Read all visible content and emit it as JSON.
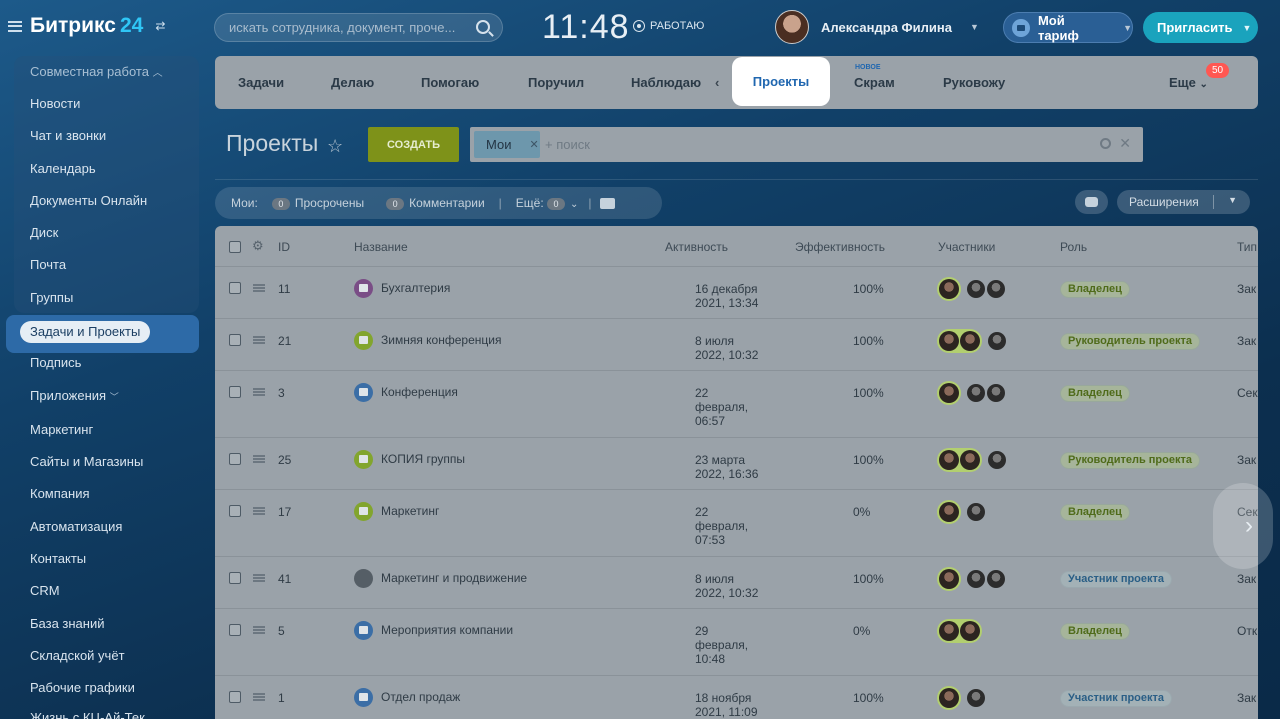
{
  "header": {
    "logo_text": "Битрикс",
    "logo_num": "24",
    "search_placeholder": "искать сотрудника, документ, проче...",
    "clock": "11:48",
    "work_status": "РАБОТАЮ",
    "user_name": "Александра Филина",
    "tariff_label": "Мой тариф",
    "invite_label": "Пригласить"
  },
  "sidebar": {
    "group_title": "Совместная работа",
    "group_items": [
      "Новости",
      "Чат и звонки",
      "Календарь",
      "Документы Онлайн",
      "Диск",
      "Почта",
      "Группы"
    ],
    "active_item": "Задачи и Проекты",
    "items": [
      "Подпись",
      "Приложения",
      "Маркетинг",
      "Сайты и Магазины",
      "Компания",
      "Автоматизация",
      "Контакты",
      "CRM",
      "База знаний",
      "Складской учёт",
      "Рабочие графики",
      "Жизнь с КЦ-Ай-Тек"
    ]
  },
  "tabs": {
    "items": [
      "Задачи",
      "Делаю",
      "Помогаю",
      "Поручил",
      "Наблюдаю"
    ],
    "active": "Проекты",
    "scrum": "Скрам",
    "scrum_tag": "НОВОЕ",
    "manage": "Руковожу",
    "more": "Еще",
    "more_counter": "50"
  },
  "toolbar": {
    "page_title": "Проекты",
    "create_label": "СОЗДАТЬ",
    "filter_chip": "Мои",
    "filter_placeholder": "+ поиск"
  },
  "counters": {
    "mine_label": "Мои:",
    "overdue_count": "0",
    "overdue_label": "Просрочены",
    "comments_count": "0",
    "comments_label": "Комментарии",
    "more_label": "Ещё:",
    "more_count": "0",
    "extensions_label": "Расширения"
  },
  "table": {
    "headers": {
      "id": "ID",
      "name": "Название",
      "activity": "Активность",
      "efficiency": "Эффективность",
      "members": "Участники",
      "role": "Роль",
      "type": "Тип"
    },
    "rows": [
      {
        "id": "11",
        "name": "Бухгалтерия",
        "act": [
          "16 декабря",
          "2021, 13:34"
        ],
        "eff": "100%",
        "role": "Владелец",
        "type": "Зак"
      },
      {
        "id": "21",
        "name": "Зимняя конференция",
        "act": [
          "8 июля",
          "2022, 10:32"
        ],
        "eff": "100%",
        "role": "Руководитель проекта",
        "type": "Зак"
      },
      {
        "id": "3",
        "name": "Конференция",
        "act": [
          "22",
          "февраля,",
          "06:57"
        ],
        "eff": "100%",
        "role": "Владелец",
        "type": "Сек"
      },
      {
        "id": "25",
        "name": "КОПИЯ группы",
        "act": [
          "23 марта",
          "2022, 16:36"
        ],
        "eff": "100%",
        "role": "Руководитель проекта",
        "type": "Зак"
      },
      {
        "id": "17",
        "name": "Маркетинг",
        "act": [
          "22",
          "февраля,",
          "07:53"
        ],
        "eff": "0%",
        "role": "Владелец",
        "type": "Сек"
      },
      {
        "id": "41",
        "name": "Маркетинг и продвижение",
        "act": [
          "8 июля",
          "2022, 10:32"
        ],
        "eff": "100%",
        "role": "Участник проекта",
        "type": "Зак"
      },
      {
        "id": "5",
        "name": "Мероприятия компании",
        "act": [
          "29",
          "февраля,",
          "10:48"
        ],
        "eff": "0%",
        "role": "Владелец",
        "type": "Отк"
      },
      {
        "id": "1",
        "name": "Отдел продаж",
        "act": [
          "18 ноября",
          "2021, 11:09"
        ],
        "eff": "100%",
        "role": "Участник проекта",
        "type": "Зак"
      }
    ]
  }
}
